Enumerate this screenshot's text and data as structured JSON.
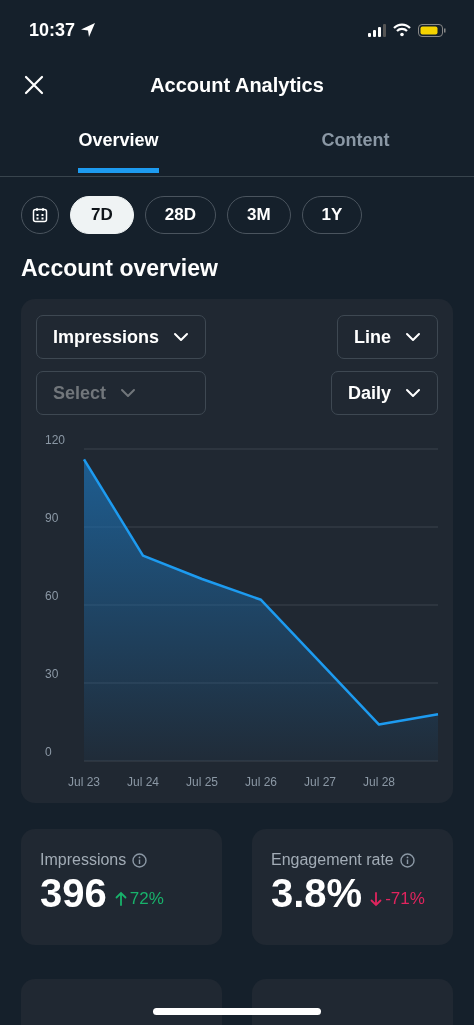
{
  "status_bar": {
    "time": "10:37"
  },
  "header": {
    "title": "Account Analytics"
  },
  "tabs": [
    {
      "label": "Overview",
      "selected": true
    },
    {
      "label": "Content",
      "selected": false
    }
  ],
  "ranges": [
    {
      "label": "7D",
      "selected": true
    },
    {
      "label": "28D",
      "selected": false
    },
    {
      "label": "3M",
      "selected": false
    },
    {
      "label": "1Y",
      "selected": false
    }
  ],
  "section_title": "Account overview",
  "dropdowns": [
    {
      "label": "Impressions",
      "disabled": false
    },
    {
      "label": "Line",
      "disabled": false
    },
    {
      "label": "Select",
      "disabled": true
    },
    {
      "label": "Daily",
      "disabled": false
    }
  ],
  "chart_data": {
    "type": "area",
    "categories": [
      "Jul 23",
      "Jul 24",
      "Jul 25",
      "Jul 26",
      "Jul 27",
      "Jul 28",
      null
    ],
    "series": [
      {
        "color": "#1d9bf0",
        "values": [
          116,
          79,
          70,
          62,
          38,
          14,
          18
        ]
      }
    ],
    "ylim": [
      0,
      120
    ],
    "yticks": [
      0,
      30,
      60,
      90,
      120
    ],
    "grid": true
  },
  "stats": [
    {
      "label": "Impressions",
      "value": "396",
      "change": "72%",
      "kind": "up"
    },
    {
      "label": "Engagement rate",
      "value": "3.8%",
      "change": "-71%",
      "kind": "down"
    }
  ]
}
